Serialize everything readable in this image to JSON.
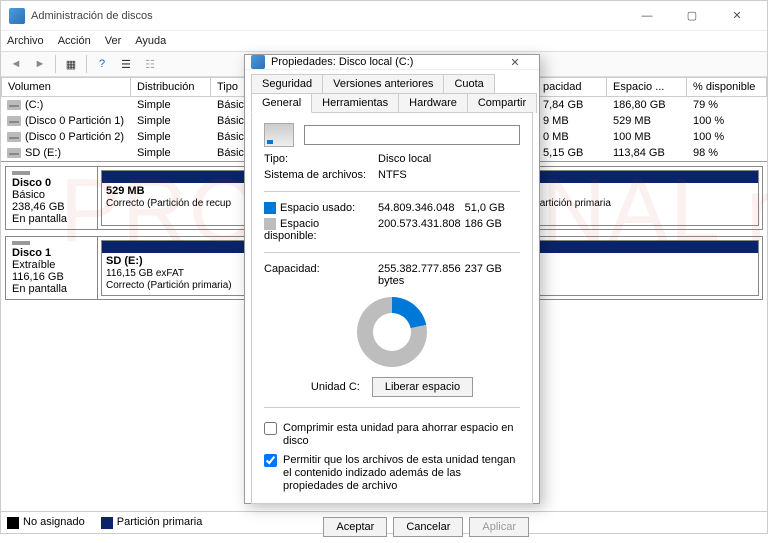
{
  "window": {
    "title": "Administración de discos",
    "menu": {
      "file": "Archivo",
      "action": "Acción",
      "view": "Ver",
      "help": "Ayuda"
    }
  },
  "columns": {
    "volume": "Volumen",
    "layout": "Distribución",
    "type": "Tipo",
    "capacity": "pacidad",
    "free": "Espacio ...",
    "pct": "% disponible"
  },
  "volumes": [
    {
      "name": "(C:)",
      "layout": "Simple",
      "type": "Básico",
      "cap": "7,84 GB",
      "free": "186,80 GB",
      "pct": "79 %"
    },
    {
      "name": "(Disco 0 Partición 1)",
      "layout": "Simple",
      "type": "Básico",
      "cap": "9 MB",
      "free": "529 MB",
      "pct": "100 %"
    },
    {
      "name": "(Disco 0 Partición 2)",
      "layout": "Simple",
      "type": "Básico",
      "cap": "0 MB",
      "free": "100 MB",
      "pct": "100 %"
    },
    {
      "name": "SD (E:)",
      "layout": "Simple",
      "type": "Básico",
      "cap": "5,15 GB",
      "free": "113,84 GB",
      "pct": "98 %"
    }
  ],
  "disks": [
    {
      "label": "Disco 0",
      "kind": "Básico",
      "size": "238,46 GB",
      "status": "En pantalla",
      "parts": [
        {
          "title": "529 MB",
          "sub": "Correcto (Partición de recup"
        },
        {
          "title": "",
          "sub": "paginación, Volcado, Partición primaria"
        }
      ]
    },
    {
      "label": "Disco 1",
      "kind": "Extraíble",
      "size": "116,16 GB",
      "status": "En pantalla",
      "parts": [
        {
          "title": "SD  (E:)",
          "sub": "116,15 GB exFAT",
          "sub2": "Correcto (Partición primaria)"
        }
      ]
    }
  ],
  "legend": {
    "unalloc": "No asignado",
    "primary": "Partición primaria"
  },
  "dialog": {
    "title": "Propiedades: Disco local (C:)",
    "tabs": {
      "security": "Seguridad",
      "prev": "Versiones anteriores",
      "quota": "Cuota",
      "general": "General",
      "tools": "Herramientas",
      "hw": "Hardware",
      "share": "Compartir"
    },
    "type_label": "Tipo:",
    "type_value": "Disco local",
    "fs_label": "Sistema de archivos:",
    "fs_value": "NTFS",
    "used_label": "Espacio usado:",
    "used_bytes": "54.809.346.048",
    "used_gb": "51,0 GB",
    "free_label": "Espacio disponible:",
    "free_bytes": "200.573.431.808",
    "free_gb": "186 GB",
    "cap_label": "Capacidad:",
    "cap_bytes": "255.382.777.856 bytes",
    "cap_gb": "237 GB",
    "drive_caption": "Unidad C:",
    "cleanup": "Liberar espacio",
    "compress": "Comprimir esta unidad para ahorrar espacio en disco",
    "index": "Permitir que los archivos de esta unidad tengan el contenido indizado además de las propiedades de archivo",
    "ok": "Aceptar",
    "cancel": "Cancelar",
    "apply": "Aplicar"
  },
  "watermark": "PROFESIONAL review"
}
